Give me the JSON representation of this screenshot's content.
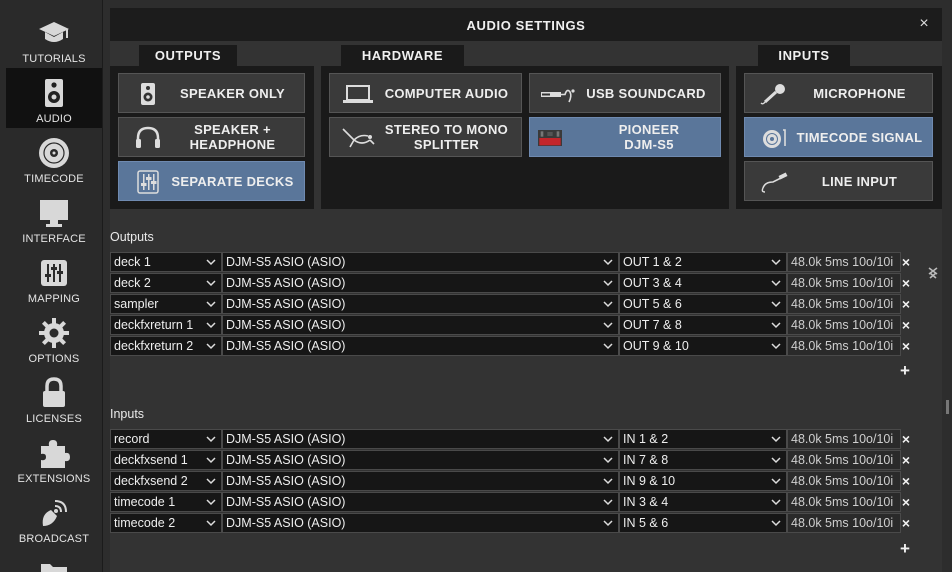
{
  "sidebar": {
    "items": [
      {
        "label": "TUTORIALS",
        "icon": "graduation-cap-icon"
      },
      {
        "label": "AUDIO",
        "icon": "speaker-icon",
        "active": true
      },
      {
        "label": "TIMECODE",
        "icon": "vinyl-icon"
      },
      {
        "label": "INTERFACE",
        "icon": "monitor-icon"
      },
      {
        "label": "MAPPING",
        "icon": "sliders-icon"
      },
      {
        "label": "OPTIONS",
        "icon": "gear-icon"
      },
      {
        "label": "LICENSES",
        "icon": "lock-icon"
      },
      {
        "label": "EXTENSIONS",
        "icon": "puzzle-icon"
      },
      {
        "label": "BROADCAST",
        "icon": "broadcast-icon"
      }
    ]
  },
  "window": {
    "title": "AUDIO SETTINGS",
    "close": "×"
  },
  "tabs": {
    "outputs": "OUTPUTS",
    "hardware": "HARDWARE",
    "inputs": "INPUTS"
  },
  "outputs_buttons": [
    {
      "label": "SPEAKER ONLY",
      "icon": "speaker-icon"
    },
    {
      "label": "SPEAKER + HEADPHONE",
      "icon": "headphones-icon"
    },
    {
      "label": "SEPARATE DECKS",
      "icon": "mixer-icon",
      "selected": true
    }
  ],
  "hardware_buttons": [
    {
      "label": "COMPUTER AUDIO",
      "icon": "laptop-icon"
    },
    {
      "label": "USB SOUNDCARD",
      "icon": "usb-soundcard-icon"
    },
    {
      "label": "STEREO TO MONO SPLITTER",
      "icon": "splitter-cable-icon"
    },
    {
      "label": "PIONEER DJM-S5",
      "icon": "pioneer-mixer-icon",
      "selected": true
    }
  ],
  "inputs_buttons": [
    {
      "label": "MICROPHONE",
      "icon": "microphone-icon"
    },
    {
      "label": "TIMECODE SIGNAL",
      "icon": "timecode-vinyl-icon",
      "selected": true
    },
    {
      "label": "LINE INPUT",
      "icon": "line-cable-icon"
    }
  ],
  "outputs": {
    "label": "Outputs",
    "rows": [
      {
        "channel": "deck 1",
        "device": "DJM-S5 ASIO (ASIO)",
        "port": "OUT 1 & 2",
        "info": "48.0k 5ms 10o/10i"
      },
      {
        "channel": "deck 2",
        "device": "DJM-S5 ASIO (ASIO)",
        "port": "OUT 3 & 4",
        "info": "48.0k 5ms 10o/10i"
      },
      {
        "channel": "sampler",
        "device": "DJM-S5 ASIO (ASIO)",
        "port": "OUT 5 & 6",
        "info": "48.0k 5ms 10o/10i"
      },
      {
        "channel": "deckfxreturn 1",
        "device": "DJM-S5 ASIO (ASIO)",
        "port": "OUT 7 & 8",
        "info": "48.0k 5ms 10o/10i"
      },
      {
        "channel": "deckfxreturn 2",
        "device": "DJM-S5 ASIO (ASIO)",
        "port": "OUT 9 & 10",
        "info": "48.0k 5ms 10o/10i"
      }
    ]
  },
  "inputs": {
    "label": "Inputs",
    "rows": [
      {
        "channel": "record",
        "device": "DJM-S5 ASIO (ASIO)",
        "port": "IN 1 & 2",
        "info": "48.0k 5ms 10o/10i"
      },
      {
        "channel": "deckfxsend 1",
        "device": "DJM-S5 ASIO (ASIO)",
        "port": "IN 7 & 8",
        "info": "48.0k 5ms 10o/10i"
      },
      {
        "channel": "deckfxsend 2",
        "device": "DJM-S5 ASIO (ASIO)",
        "port": "IN 9 & 10",
        "info": "48.0k 5ms 10o/10i"
      },
      {
        "channel": "timecode 1",
        "device": "DJM-S5 ASIO (ASIO)",
        "port": "IN 3 & 4",
        "info": "48.0k 5ms 10o/10i"
      },
      {
        "channel": "timecode 2",
        "device": "DJM-S5 ASIO (ASIO)",
        "port": "IN 5 & 6",
        "info": "48.0k 5ms 10o/10i"
      }
    ]
  },
  "controls": {
    "remove": "×",
    "add": "+"
  },
  "colors": {
    "selected": "#5a769a",
    "panel": "#1a1a1a",
    "background": "#2d2d2d"
  }
}
